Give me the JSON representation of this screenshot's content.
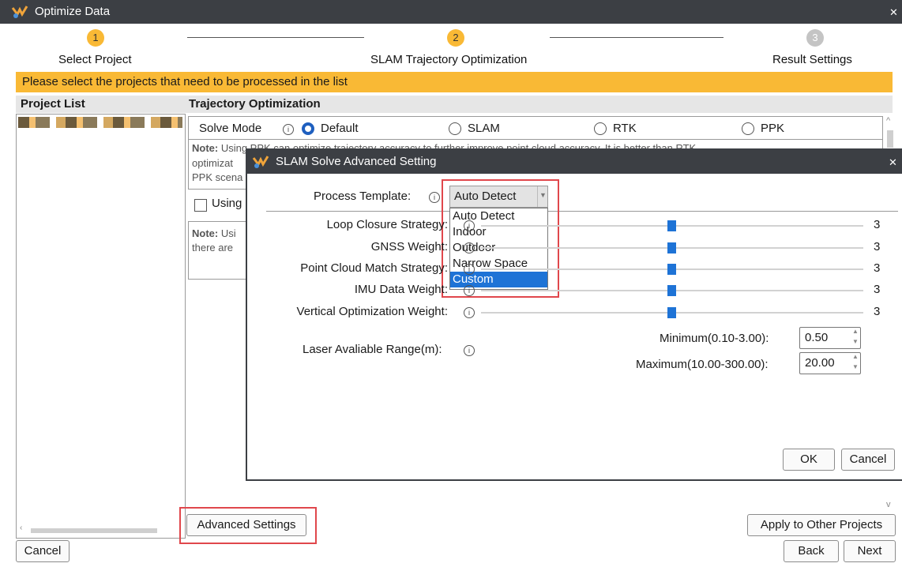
{
  "window": {
    "title": "Optimize Data"
  },
  "steps": [
    {
      "num": "1",
      "label": "Select Project"
    },
    {
      "num": "2",
      "label": "SLAM Trajectory Optimization"
    },
    {
      "num": "3",
      "label": "Result Settings"
    }
  ],
  "banner": "Please select the projects that need to be processed in the list",
  "project_list": {
    "header": "Project List"
  },
  "trajectory": {
    "header": "Trajectory Optimization",
    "solve_mode_label": "Solve Mode",
    "modes": [
      "Default",
      "SLAM",
      "RTK",
      "PPK"
    ],
    "selected_mode": "Default",
    "note1_bold": "Note:",
    "note1_line1": " Using PPK can optimize trajectory accuracy to further improve point cloud accuracy. It is better than RTK",
    "note1_line2": "optimizat",
    "note1_line3": "PPK scena",
    "using_label": "Using",
    "note2_bold": "Note:",
    "note2_line1": " Usi",
    "note2_line2": "there are"
  },
  "buttons": {
    "advanced": "Advanced Settings",
    "apply_other": "Apply to Other Projects",
    "cancel": "Cancel",
    "back": "Back",
    "next": "Next"
  },
  "dialog": {
    "title": "SLAM Solve Advanced Setting",
    "process_template_label": "Process Template:",
    "process_template_value": "Auto Detect",
    "dropdown_options": [
      "Auto Detect",
      "Indoor",
      "Outdoor",
      "Narrow Space",
      "Custom"
    ],
    "highlighted_option": "Custom",
    "sliders": [
      {
        "label": "Loop Closure Strategy:",
        "value": "3",
        "level": 3
      },
      {
        "label": "GNSS Weight:",
        "value": "3",
        "level": 3
      },
      {
        "label": "Point Cloud Match Strategy:",
        "value": "3",
        "level": 3
      },
      {
        "label": "IMU Data Weight:",
        "value": "3",
        "level": 3
      },
      {
        "label": "Vertical Optimization Weight:",
        "value": "3",
        "level": 3
      }
    ],
    "laser_range_label": "Laser Avaliable Range(m):",
    "minimum_label": "Minimum(0.10-3.00):",
    "minimum_value": "0.50",
    "maximum_label": "Maximum(10.00-300.00):",
    "maximum_value": "20.00",
    "ok": "OK",
    "cancel": "Cancel"
  },
  "colors": {
    "accent": "#1e5fbf",
    "banner": "#f9b935",
    "highlight_box": "#e0474c",
    "titlebar": "#3c3f44"
  }
}
